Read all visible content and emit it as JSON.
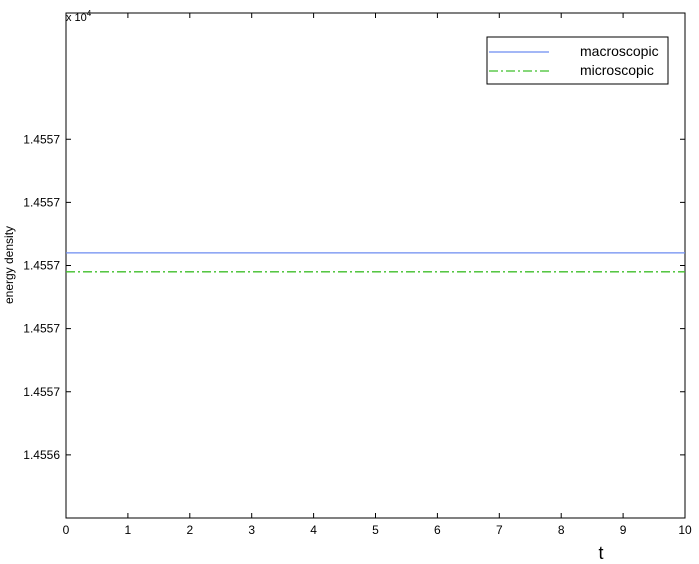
{
  "chart_data": {
    "type": "line",
    "title": "",
    "xlabel": "t",
    "ylabel": "energy density",
    "y_exponent_label": "x 10",
    "y_exponent_power": "4",
    "xlim": [
      0,
      10
    ],
    "ylim": [
      1.45562,
      1.4557
    ],
    "x_ticks": [
      0,
      1,
      2,
      3,
      4,
      5,
      6,
      7,
      8,
      9,
      10
    ],
    "x_tick_labels": [
      "0",
      "1",
      "2",
      "3",
      "4",
      "5",
      "6",
      "7",
      "8",
      "9",
      "10"
    ],
    "y_ticks": [
      1.45563,
      1.45564,
      1.45565,
      1.45566,
      1.45567,
      1.45568
    ],
    "y_tick_labels": [
      "1.4556",
      "1.4557",
      "1.4557",
      "1.4557",
      "1.4557",
      "1.4557"
    ],
    "grid": false,
    "legend_position": "top-right",
    "series": [
      {
        "name": "macroscopic",
        "x": [
          0,
          10
        ],
        "y": [
          1.455662,
          1.455662
        ],
        "color": "#6c8cf0",
        "style": "solid"
      },
      {
        "name": "microscopic",
        "x": [
          0,
          10
        ],
        "y": [
          1.455659,
          1.455659
        ],
        "color": "#3fbf2a",
        "style": "dashdot"
      }
    ]
  }
}
